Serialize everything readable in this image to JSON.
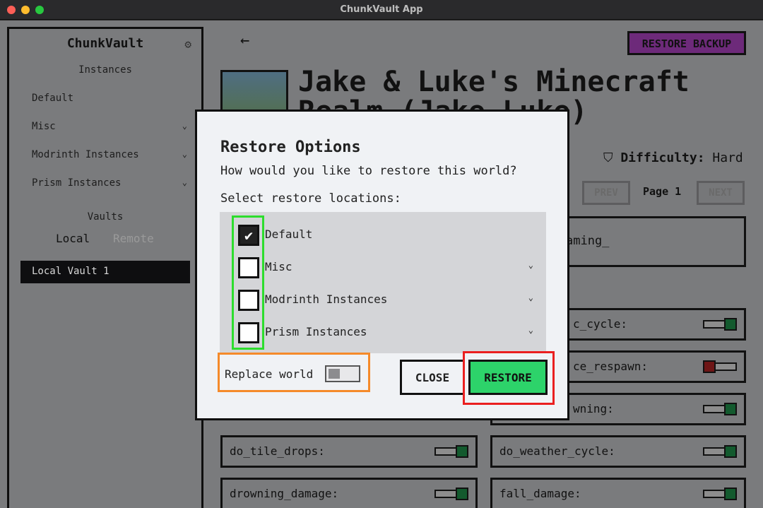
{
  "window": {
    "title": "ChunkVault App"
  },
  "sidebar": {
    "brand": "ChunkVault",
    "instances_heading": "Instances",
    "items": [
      {
        "label": "Default",
        "expandable": false
      },
      {
        "label": "Misc",
        "expandable": true
      },
      {
        "label": "Modrinth Instances",
        "expandable": true
      },
      {
        "label": "Prism Instances",
        "expandable": true
      }
    ],
    "vaults_heading": "Vaults",
    "vault_tabs": {
      "local": "Local",
      "remote": "Remote"
    },
    "vault_items": [
      "Local Vault 1"
    ]
  },
  "header": {
    "restore_backup_label": "RESTORE BACKUP",
    "world_title": "Jake & Luke's Minecraft Realm (Jake Luke)",
    "difficulty_label": "Difficulty:",
    "difficulty_value": "Hard"
  },
  "pager": {
    "prev": "PREV",
    "page": "Page 1",
    "next": "NEXT"
  },
  "search": {
    "visible_text": "aming_"
  },
  "gamerules": [
    {
      "name": "c_cycle:",
      "enabled": true
    },
    {
      "name": "ce_respawn:",
      "enabled": false
    },
    {
      "name": "wning:",
      "enabled": true
    },
    {
      "name": "do_tile_drops:",
      "enabled": true
    },
    {
      "name": "do_weather_cycle:",
      "enabled": true
    },
    {
      "name": "drowning_damage:",
      "enabled": true
    },
    {
      "name": "fall_damage:",
      "enabled": true
    }
  ],
  "modal": {
    "title": "Restore Options",
    "question": "How would you like to restore this world?",
    "select_label": "Select restore locations:",
    "locations": [
      {
        "label": "Default",
        "checked": true,
        "expandable": false
      },
      {
        "label": "Misc",
        "checked": false,
        "expandable": true
      },
      {
        "label": "Modrinth Instances",
        "checked": false,
        "expandable": true
      },
      {
        "label": "Prism Instances",
        "checked": false,
        "expandable": true
      }
    ],
    "replace_world_label": "Replace world",
    "replace_world_enabled": false,
    "close_label": "CLOSE",
    "restore_label": "RESTORE"
  },
  "colors": {
    "accent_restore": "#2dd36a",
    "restore_backup": "#6d2a7a",
    "highlight_green": "#2ddd2d",
    "highlight_orange": "#f58a2a",
    "highlight_red": "#ea1f1f"
  },
  "icons": {
    "back": "arrow-left-icon",
    "settings": "gear-icon",
    "chevron": "chevron-down-icon",
    "difficulty": "shield-icon",
    "check": "check-icon"
  }
}
